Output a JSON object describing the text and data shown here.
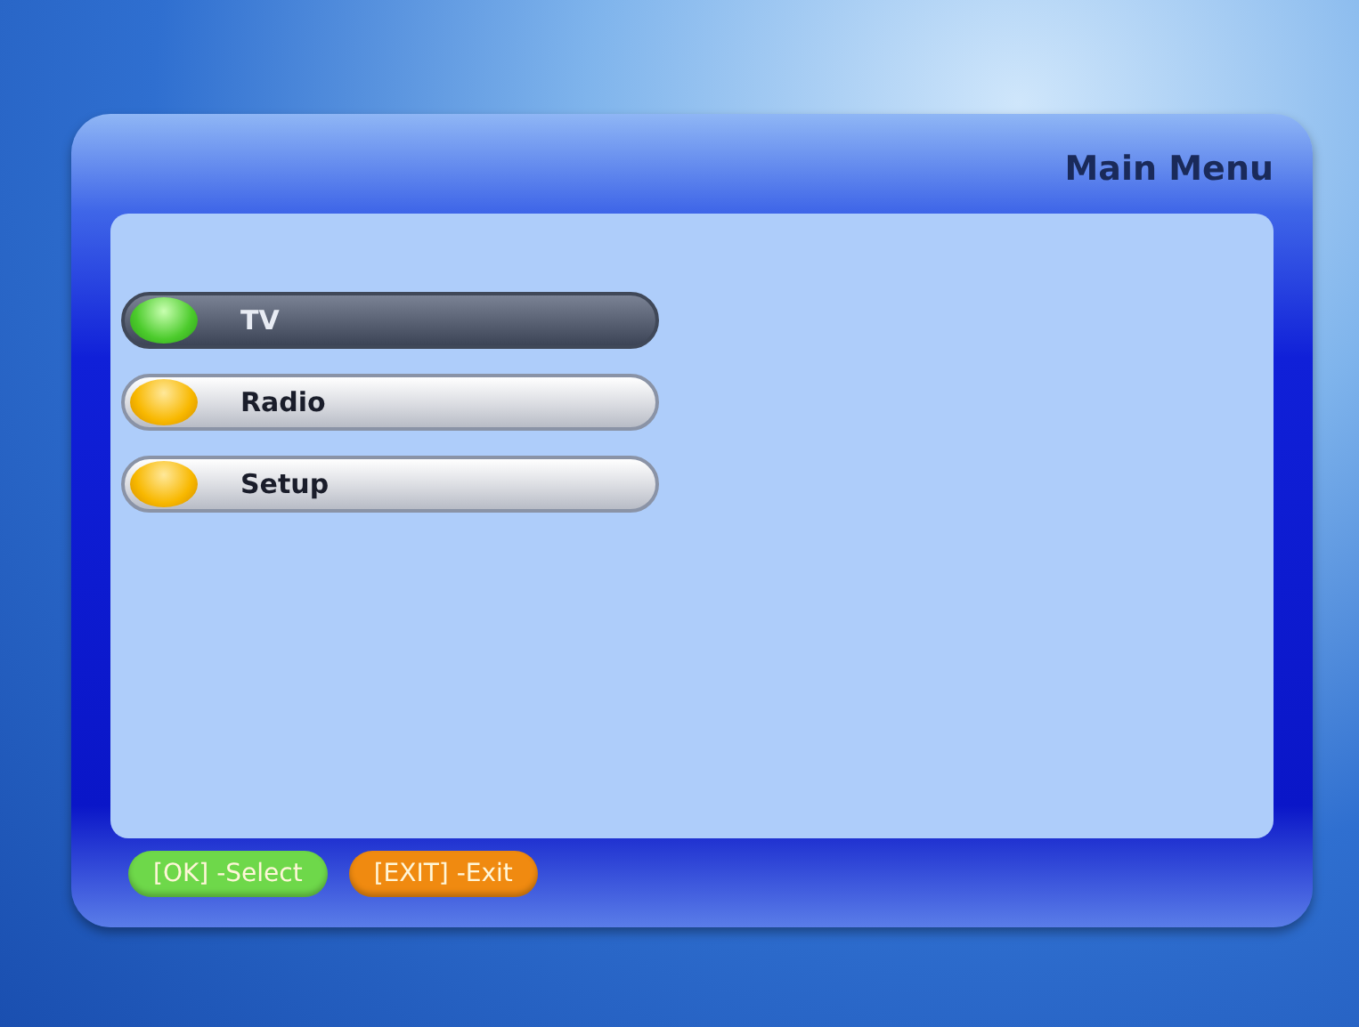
{
  "window": {
    "title": "Main Menu"
  },
  "menu": [
    {
      "label": "TV",
      "selected": true
    },
    {
      "label": "Radio",
      "selected": false
    },
    {
      "label": "Setup",
      "selected": false
    }
  ],
  "hints": [
    {
      "label": "[OK] -Select",
      "color": "#6ed84a"
    },
    {
      "label": "[EXIT] -Exit",
      "color": "#f08a10"
    }
  ]
}
